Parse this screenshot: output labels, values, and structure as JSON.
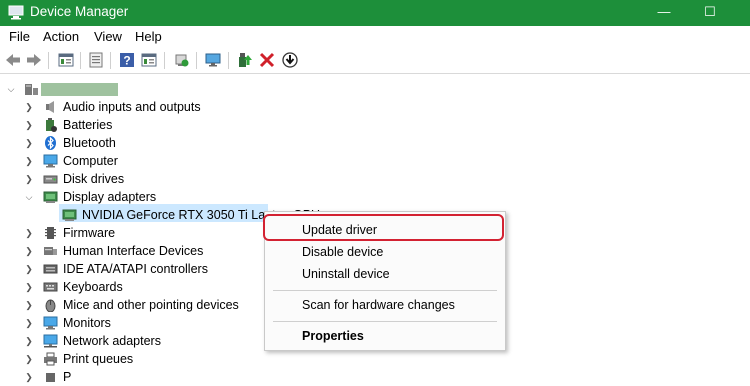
{
  "window": {
    "title": "Device Manager",
    "minimize_glyph": "—",
    "maximize_glyph": "☐"
  },
  "menu": [
    "File",
    "Action",
    "View",
    "Help"
  ],
  "toolbar_icons": [
    "back-icon",
    "forward-icon",
    "properties-sheet-icon",
    "help-page-icon",
    "help-icon",
    "list-view-icon",
    "refresh-hardware-icon",
    "monitor-icon",
    "update-driver-icon",
    "uninstall-icon",
    "download-icon"
  ],
  "tree": {
    "root_label": "",
    "items": [
      {
        "label": "Audio inputs and outputs",
        "icon": "speaker-icon"
      },
      {
        "label": "Batteries",
        "icon": "battery-icon"
      },
      {
        "label": "Bluetooth",
        "icon": "bluetooth-icon"
      },
      {
        "label": "Computer",
        "icon": "computer-icon"
      },
      {
        "label": "Disk drives",
        "icon": "disk-drive-icon"
      },
      {
        "label": "Display adapters",
        "icon": "display-adapter-icon",
        "expanded": true
      },
      {
        "label": "NVIDIA GeForce RTX 3050 Ti Laptop GPU",
        "icon": "gpu-icon",
        "child": true,
        "selected": true
      },
      {
        "label": "Firmware",
        "icon": "firmware-icon"
      },
      {
        "label": "Human Interface Devices",
        "icon": "hid-icon"
      },
      {
        "label": "IDE ATA/ATAPI controllers",
        "icon": "ide-controller-icon"
      },
      {
        "label": "Keyboards",
        "icon": "keyboard-icon"
      },
      {
        "label": "Mice and other pointing devices",
        "icon": "mouse-icon"
      },
      {
        "label": "Monitors",
        "icon": "monitor-icon"
      },
      {
        "label": "Network adapters",
        "icon": "network-adapter-icon"
      },
      {
        "label": "Print queues",
        "icon": "printer-icon"
      },
      {
        "label": "P",
        "icon": "processor-icon"
      }
    ]
  },
  "context_menu": {
    "items": [
      "Update driver",
      "Disable device",
      "Uninstall device",
      "Scan for hardware changes",
      "Properties"
    ]
  },
  "colors": {
    "titlebar": "#1d8f3a",
    "selection": "#cce8ff",
    "highlight_border": "#d32232"
  }
}
